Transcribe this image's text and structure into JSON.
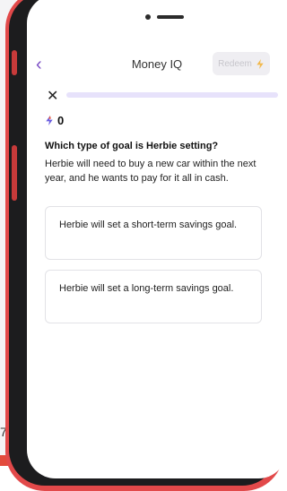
{
  "edge_text": "7",
  "header": {
    "title": "Money IQ",
    "back_icon": "chevron-left-icon",
    "redeem_label": "Redeem"
  },
  "progress": {
    "fraction": 0
  },
  "points": {
    "value": "0",
    "icon": "bolt-icon"
  },
  "question": {
    "title": "Which type of goal is Herbie setting?",
    "prompt": "Herbie will need to buy a new car within the next year, and he wants to pay for it all in cash."
  },
  "options": [
    {
      "label": "Herbie will set a short-term savings goal."
    },
    {
      "label": "Herbie will set a long-term savings goal."
    }
  ],
  "colors": {
    "accent": "#7a4bc4",
    "phone_case": "#e2494a",
    "progress_track": "#e7e2fb"
  }
}
